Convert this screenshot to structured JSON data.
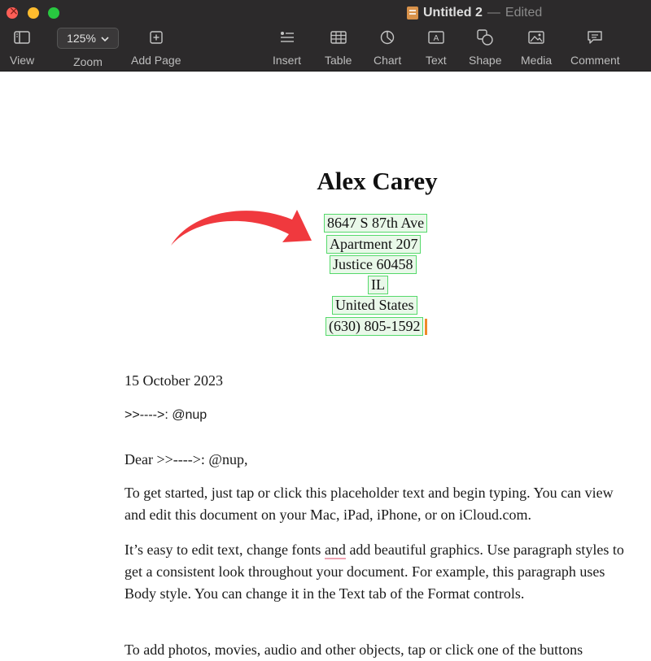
{
  "window": {
    "title": "Untitled 2",
    "separator": "—",
    "status": "Edited"
  },
  "toolbar": {
    "view_label": "View",
    "zoom_value": "125%",
    "zoom_label": "Zoom",
    "add_page_label": "Add Page",
    "insert_label": "Insert",
    "table_label": "Table",
    "chart_label": "Chart",
    "text_label": "Text",
    "shape_label": "Shape",
    "media_label": "Media",
    "comment_label": "Comment"
  },
  "document": {
    "name": "Alex Carey",
    "address": [
      "8647 S 87th Ave",
      "Apartment 207",
      "Justice 60458",
      "IL",
      "United States",
      "(630) 805-1592"
    ],
    "date": "15 October 2023",
    "recipient": ">>---->: @nup",
    "greeting": "Dear >>---->: @nup,",
    "para1": "To get started, just tap or click this placeholder text and begin typing. You can view and edit this document on your Mac, iPad, iPhone, or on iCloud.com.",
    "para2_before": "It’s easy to edit text, change fonts ",
    "para2_underlined": "and",
    "para2_after": " add beautiful graphics. Use paragraph styles to get a consistent look throughout your document. For example, this paragraph uses Body style. You can change it in the Text tab of the Format controls.",
    "para3": "To add photos, movies, audio and other objects, tap or click one of the buttons"
  },
  "colors": {
    "arrow": "#f0393e",
    "highlight_border": "#55d96b",
    "highlight_fill": "#e9f8e9",
    "caret": "#ef8a2a"
  }
}
